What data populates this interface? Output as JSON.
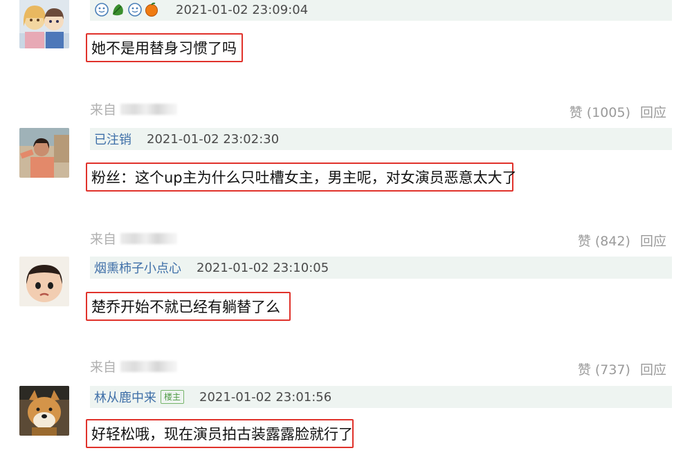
{
  "comments": [
    {
      "username": "",
      "time": "2021-01-02 23:09:04",
      "text": "她不是用替身习惯了吗",
      "is_op": false,
      "emoji_names": [
        "blue-smiley-icon",
        "green-leaf-icon",
        "blue-smiley-icon",
        "orange-icon"
      ],
      "from_label": "来自",
      "likes_label": "赞 (1005)",
      "reply_label": "回应"
    },
    {
      "username": "已注销",
      "time": "2021-01-02 23:02:30",
      "text": "粉丝：这个up主为什么只吐槽女主，男主呢，对女演员恶意太大了",
      "is_op": false,
      "from_label": "来自",
      "likes_label": "赞 (842)",
      "reply_label": "回应"
    },
    {
      "username": "烟熏柿子小点心",
      "time": "2021-01-02 23:10:05",
      "text": "楚乔开始不就已经有躺替了么",
      "is_op": false,
      "from_label": "来自",
      "likes_label": "赞 (737)",
      "reply_label": "回应"
    },
    {
      "username": "林从鹿中来",
      "op_badge": "楼主",
      "time": "2021-01-02 23:01:56",
      "text": "好轻松哦，现在演员拍古装露露脸就行了",
      "is_op": true
    }
  ],
  "colors": {
    "highlight_border": "#e0322b",
    "header_bg": "#eef4f1",
    "username": "#3f6fa8",
    "op_badge": "#4e9a44"
  }
}
